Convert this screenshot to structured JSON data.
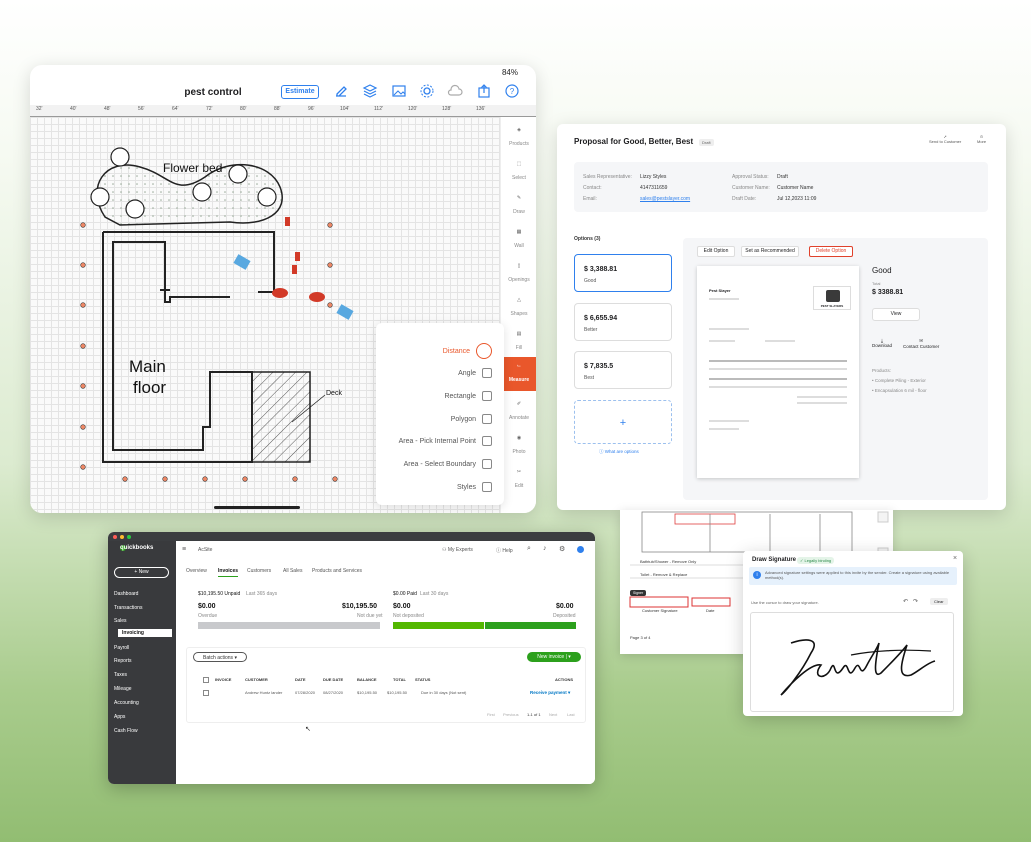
{
  "tablet": {
    "title": "pest control",
    "status": "84%",
    "estimate_label": "Estimate",
    "ruler_ticks": [
      "32'",
      "40'",
      "48'",
      "56'",
      "64'",
      "72'",
      "80'",
      "88'",
      "96'",
      "104'",
      "112'",
      "120'",
      "128'",
      "136'"
    ],
    "tools": [
      {
        "label": "Products",
        "icon": "tag-icon"
      },
      {
        "label": "Select",
        "icon": "select-icon"
      },
      {
        "label": "Draw",
        "icon": "pen-icon"
      },
      {
        "label": "Wall",
        "icon": "wall-icon"
      },
      {
        "label": "Openings",
        "icon": "door-icon"
      },
      {
        "label": "Shapes",
        "icon": "shapes-icon"
      },
      {
        "label": "Fill",
        "icon": "fill-icon"
      },
      {
        "label": "Measure",
        "icon": "ruler-icon"
      },
      {
        "label": "Annotate",
        "icon": "annotate-icon"
      },
      {
        "label": "Photo",
        "icon": "camera-icon"
      },
      {
        "label": "Edit",
        "icon": "scissors-icon"
      }
    ],
    "measure_menu": [
      "Distance",
      "Angle",
      "Rectangle",
      "Polygon",
      "Area - Pick Internal Point",
      "Area - Select Boundary",
      "Styles"
    ],
    "floor_labels": {
      "flower_bed": "Flower bed",
      "main_floor_1": "Main",
      "main_floor_2": "floor",
      "deck": "Deck"
    }
  },
  "proposal": {
    "title": "Proposal for Good, Better, Best",
    "status_badge": "Draft",
    "send_label": "Send to Customer",
    "more_label": "More",
    "info": {
      "rep_label": "Sales Representative:",
      "rep": "Lizzy Styles",
      "contact_label": "Contact:",
      "contact": "4147311659",
      "email_label": "Email:",
      "email": "sales@pestslayer.com",
      "approval_label": "Approval Status:",
      "approval": "Draft",
      "customer_label": "Customer Name:",
      "customer": "Customer Name",
      "date_label": "Draft Date:",
      "date": "Jul 12,2023 11:09"
    },
    "options_label": "Options (3)",
    "options": [
      {
        "amount": "$ 3,388.81",
        "name": "Good"
      },
      {
        "amount": "$ 6,655.94",
        "name": "Better"
      },
      {
        "amount": "$ 7,835.5",
        "name": "Best"
      }
    ],
    "what_are_options": "What are options",
    "buttons": {
      "edit": "Edit Option",
      "recommend": "Set as Recommended",
      "delete": "Delete Option"
    },
    "selected": {
      "name": "Good",
      "total_label": "Total",
      "total": "$ 3388.81",
      "view": "View",
      "download": "Download",
      "contact": "Contact Customer",
      "products_label": "Products:",
      "products": [
        "Complete Piling - Exterior",
        "Encapsulation 6 mil - floor"
      ]
    },
    "doc": {
      "company": "Pest Slayer",
      "logo": "PEST SLAYERS"
    }
  },
  "quickbooks": {
    "brand": "quickbooks",
    "new_label": "+ New",
    "nav": [
      "Dashboard",
      "Transactions",
      "Sales",
      "Invoicing",
      "Payroll",
      "Reports",
      "Taxes",
      "Mileage",
      "Accounting",
      "Apps",
      "Cash Flow"
    ],
    "company": "AcSite",
    "top_links": [
      "My Experts",
      "Help"
    ],
    "tabs": [
      "Overview",
      "Invoices",
      "Customers",
      "All Sales",
      "Products and Services"
    ],
    "unpaid": "$10,195.50 Unpaid",
    "unpaid_period": "Last 365 days",
    "paid": "$0.00 Paid",
    "paid_period": "Last 30 days",
    "overdue_amt": "$0.00",
    "overdue_label": "Overdue",
    "notdue_amt": "$10,195.50",
    "notdue_label": "Not due yet",
    "notdeposited_amt": "$0.00",
    "notdeposited_label": "Not deposited",
    "deposited_amt": "$0.00",
    "deposited_label": "Deposited",
    "batch_label": "Batch actions",
    "new_invoice_label": "New invoice",
    "columns": [
      "INVOICE",
      "CUSTOMER",
      "DATE",
      "DUE DATE",
      "BALANCE",
      "TOTAL",
      "STATUS",
      "ACTIONS"
    ],
    "row": {
      "customer": "Andrew Huntz lander",
      "date": "07/28/2020",
      "due": "08/27/2020",
      "balance": "$10,195.50",
      "total": "$10,195.50",
      "status": "Due in 30 days (Not sent)",
      "action": "Receive payment"
    },
    "pager": [
      "First",
      "Previous",
      "1-1 of 1",
      "Next",
      "Last"
    ]
  },
  "signature": {
    "title": "Draw Signature",
    "badge": "Legally binding",
    "info": "Advanced signature settings were applied to this invite by the sender. Create a signature using available method(s).",
    "hint": "Use the cursor to draw your signature.",
    "clear": "Clear",
    "page_label": "Page 3 of 4",
    "customer_sig": "Customer Signature",
    "date_label": "Date",
    "signer_badge": "Signer",
    "rows": [
      "Bathtub/Shower - Remove Only",
      "Toilet - Remove & Replace"
    ]
  }
}
